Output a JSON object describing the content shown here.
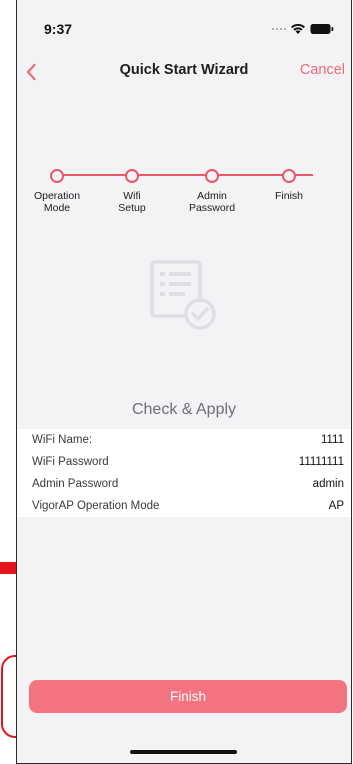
{
  "status_bar": {
    "time": "9:37"
  },
  "nav": {
    "back_icon": "chevron-left-icon",
    "title": "Quick Start Wizard",
    "cancel_label": "Cancel"
  },
  "stepper": {
    "steps": [
      {
        "label": "Operation\nMode"
      },
      {
        "label": "Wifi\nSetup"
      },
      {
        "label": "Admin\nPassword"
      },
      {
        "label": "Finish"
      }
    ]
  },
  "check": {
    "icon": "checklist-check-icon",
    "title": "Check & Apply"
  },
  "summary": [
    {
      "label": "WiFi Name:",
      "value": "1111"
    },
    {
      "label": "WiFi Password",
      "value": "11111111"
    },
    {
      "label": "Admin Password",
      "value": "admin"
    },
    {
      "label": "VigorAP Operation Mode",
      "value": "AP"
    }
  ],
  "footer": {
    "finish_label": "Finish"
  },
  "colors": {
    "accent": "#ea5766",
    "button": "#f47380",
    "annotation": "#e0141c"
  }
}
